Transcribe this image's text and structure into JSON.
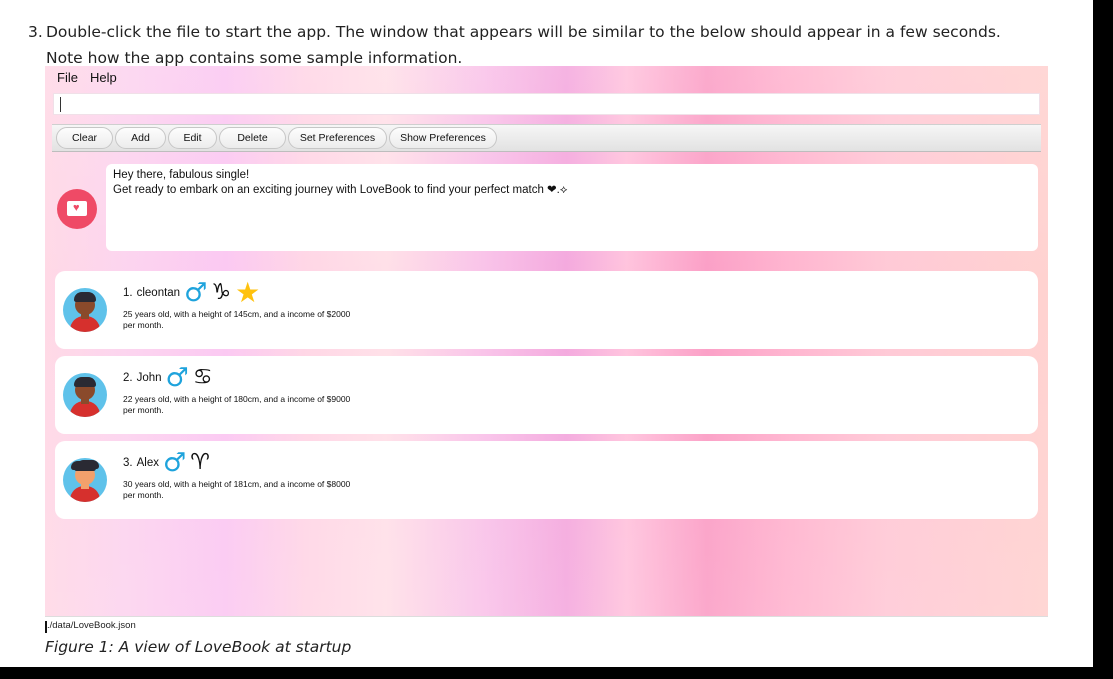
{
  "doc": {
    "step_number": "3.",
    "step_text": "Double-click the file to start the app. The window that appears will be similar to the below should appear in a few seconds. Note how the app contains some sample information.",
    "caption": "Figure 1: A view of LoveBook at startup"
  },
  "app": {
    "menu": [
      "File",
      "Help"
    ],
    "command_value": "",
    "toolbar": [
      "Clear",
      "Add",
      "Edit",
      "Delete",
      "Set Preferences",
      "Show Preferences"
    ],
    "welcome": {
      "line1": "Hey there, fabulous single!",
      "line2": "Get ready to embark on an exciting journey with LoveBook to find your perfect match ❤︎.⟡"
    },
    "people": [
      {
        "index": "1.",
        "name": "cleontan",
        "gender_icon": "male-icon",
        "zodiac_icon": "capricorn-icon",
        "extra_icon": "star-icon",
        "desc": "25 years old, with a height of 145cm, and a income of $2000 per month."
      },
      {
        "index": "2.",
        "name": "John",
        "gender_icon": "male-icon",
        "zodiac_icon": "cancer-icon",
        "desc": "22 years old, with a height of 180cm, and a income of $9000 per month."
      },
      {
        "index": "3.",
        "name": "Alex",
        "gender_icon": "male-icon",
        "zodiac_icon": "aries-icon",
        "desc": "30 years old, with a height of 181cm, and a income of $8000 per month."
      }
    ],
    "status_path": "./data/LoveBook.json"
  }
}
